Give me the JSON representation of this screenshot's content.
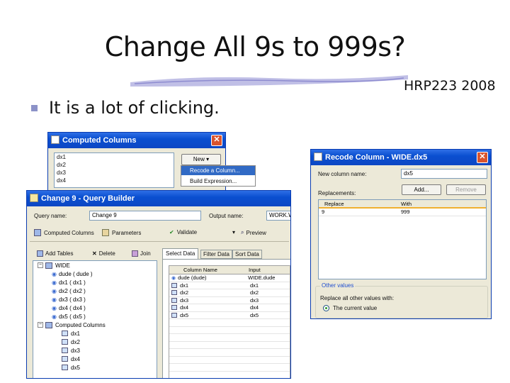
{
  "slide": {
    "title": "Change All 9s to 999s?",
    "footer": "HRP223 2008",
    "bullet": "It is a lot of clicking."
  },
  "computed_columns": {
    "title": "Computed Columns",
    "list": [
      "dx1",
      "dx2",
      "dx3",
      "dx4"
    ],
    "new_button": "New",
    "menu": [
      "Recode a Column...",
      "Build Expression..."
    ]
  },
  "query_builder": {
    "title": "Change 9 - Query Builder",
    "query_name_label": "Query name:",
    "query_name": "Change 9",
    "output_name_label": "Output name:",
    "output_name": "WORK.W",
    "toolbar": {
      "computed": "Computed Columns",
      "parameters": "Parameters",
      "validate": "Validate",
      "preview": "Preview"
    },
    "left_toolbar": {
      "add": "Add Tables",
      "delete": "Delete",
      "join": "Join"
    },
    "tabs": [
      "Select Data",
      "Filter Data",
      "Sort Data"
    ],
    "tree": {
      "root": "WIDE",
      "wide_cols": [
        "dude ( dude )",
        "dx1 ( dx1 )",
        "dx2 ( dx2 )",
        "dx3 ( dx3 )",
        "dx4 ( dx4 )",
        "dx5 ( dx5 )"
      ],
      "computed_label": "Computed Columns",
      "computed_cols": [
        "dx1",
        "dx2",
        "dx3",
        "dx4",
        "dx5"
      ]
    },
    "columns_header": [
      "Column Name",
      "Input"
    ],
    "rows": [
      [
        "dude (dude)",
        "WIDE.dude"
      ],
      [
        "dx1",
        "dx1"
      ],
      [
        "dx2",
        "dx2"
      ],
      [
        "dx3",
        "dx3"
      ],
      [
        "dx4",
        "dx4"
      ],
      [
        "dx5",
        "dx5"
      ]
    ]
  },
  "recode": {
    "title": "Recode Column - WIDE.dx5",
    "new_col_label": "New column name:",
    "new_col": "dx5",
    "replacements_label": "Replacements:",
    "add": "Add...",
    "remove": "Remove",
    "headers": [
      "Replace",
      "With"
    ],
    "rows": [
      [
        "9",
        "999"
      ]
    ],
    "other_group": "Other values",
    "other_label": "Replace all other values with:",
    "option": "The current value"
  }
}
